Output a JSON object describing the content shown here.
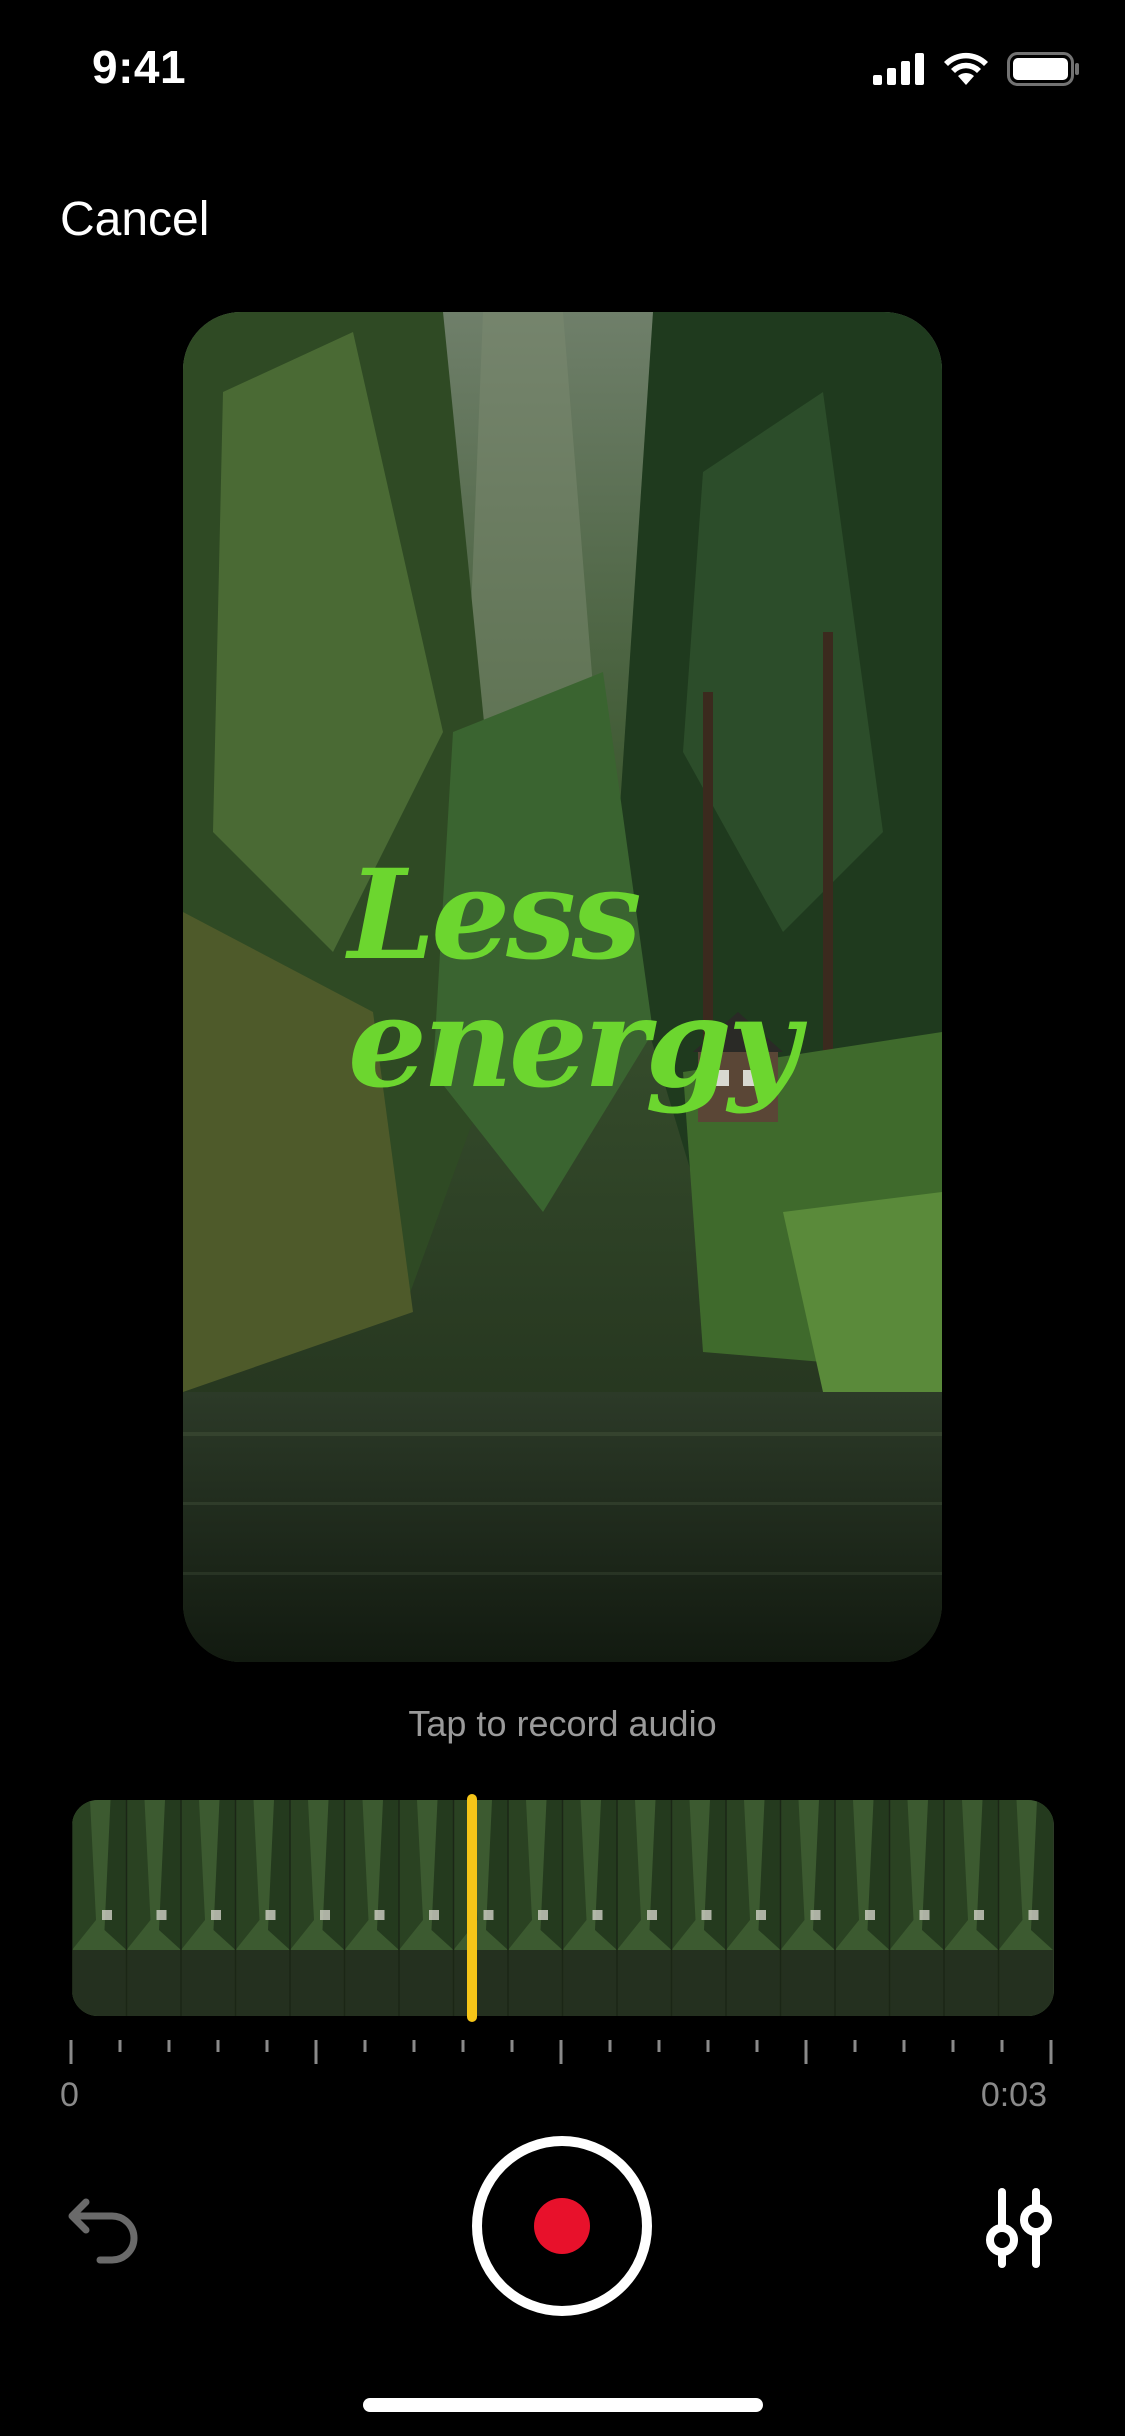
{
  "status_bar": {
    "time": "9:41"
  },
  "header": {
    "cancel_label": "Cancel"
  },
  "preview": {
    "overlay_lines": [
      "Less",
      "energy"
    ],
    "overlay_color": "#6cd62f"
  },
  "recorder": {
    "hint": "Tap to record audio",
    "time_start": "0",
    "time_end": "0:03",
    "playhead_color": "#f5c518",
    "record_color": "#e8112b"
  },
  "icons": {
    "undo": "undo-icon",
    "record": "record-icon",
    "adjust": "sliders-icon"
  }
}
